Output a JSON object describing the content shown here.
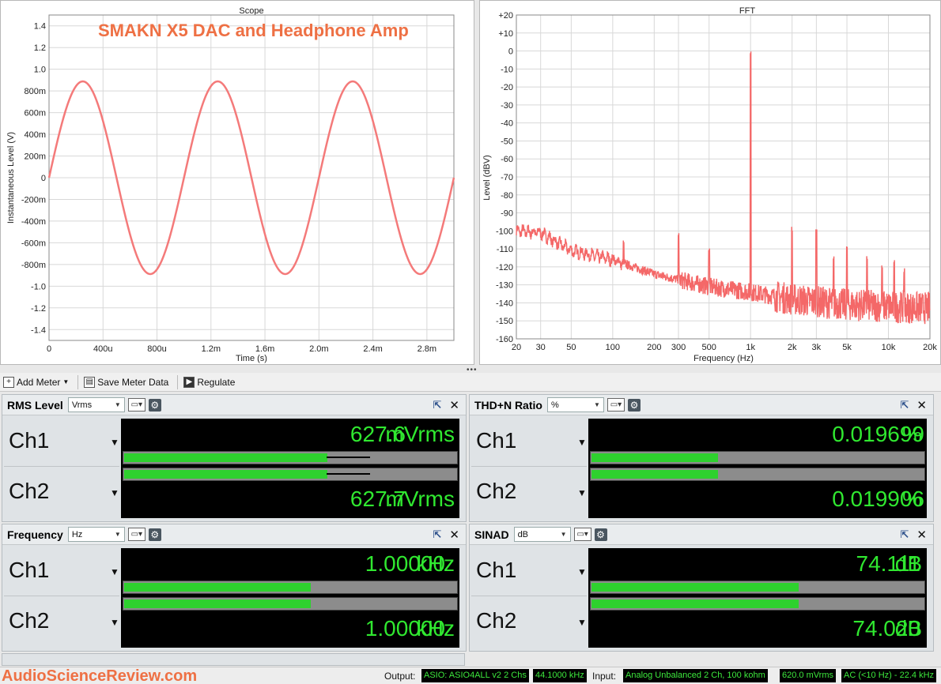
{
  "scope": {
    "title": "Scope",
    "overlay_title": "SMAKN X5 DAC and Headphone Amp",
    "xlabel": "Time (s)",
    "ylabel": "Instantaneous Level (V)",
    "x_ticks": [
      "0",
      "400u",
      "800u",
      "1.2m",
      "1.6m",
      "2.0m",
      "2.4m",
      "2.8m"
    ],
    "y_ticks": [
      "1.4",
      "1.2",
      "1.0",
      "800m",
      "600m",
      "400m",
      "200m",
      "0",
      "-200m",
      "-400m",
      "-600m",
      "-800m",
      "-1.0",
      "-1.2",
      "-1.4"
    ],
    "line_color": "#f47a7a"
  },
  "fft": {
    "title": "FFT",
    "xlabel": "Frequency (Hz)",
    "ylabel": "Level (dBV)",
    "x_ticks": [
      "20",
      "30",
      "50",
      "100",
      "200",
      "300",
      "500",
      "1k",
      "2k",
      "3k",
      "5k",
      "10k",
      "20k"
    ],
    "y_ticks": [
      "+20",
      "+10",
      "0",
      "-10",
      "-20",
      "-30",
      "-40",
      "-50",
      "-60",
      "-70",
      "-80",
      "-90",
      "-100",
      "-110",
      "-120",
      "-130",
      "-140",
      "-150",
      "-160"
    ],
    "line_color": "#f46868"
  },
  "chart_data": [
    {
      "type": "line",
      "title": "Scope",
      "xlabel": "Time (s)",
      "ylabel": "Instantaneous Level (V)",
      "xlim": [
        0,
        0.003
      ],
      "ylim": [
        -1.5,
        1.5
      ],
      "series": [
        {
          "frequency_hz": 1000,
          "amplitude_v": 0.888,
          "start_phase": "rising from 0"
        }
      ]
    },
    {
      "type": "line",
      "title": "FFT",
      "xlabel": "Frequency (Hz)",
      "ylabel": "Level (dBV)",
      "xscale": "log",
      "xlim": [
        20,
        20000
      ],
      "ylim": [
        -160,
        20
      ],
      "series": [
        {
          "fundamental": {
            "x": 1000,
            "y": -4
          },
          "harmonics": [
            {
              "x": 2000,
              "y": -102
            },
            {
              "x": 3000,
              "y": -104
            },
            {
              "x": 4000,
              "y": -118
            },
            {
              "x": 5000,
              "y": -112
            },
            {
              "x": 7000,
              "y": -118
            },
            {
              "x": 9000,
              "y": -123
            },
            {
              "x": 11000,
              "y": -120
            },
            {
              "x": 13000,
              "y": -125
            }
          ],
          "spurs": [
            {
              "x": 120,
              "y": -109
            },
            {
              "x": 300,
              "y": -105
            },
            {
              "x": 500,
              "y": -115
            }
          ],
          "noise_floor": [
            {
              "x": 20,
              "y": -100
            },
            {
              "x": 30,
              "y": -101
            },
            {
              "x": 50,
              "y": -111
            },
            {
              "x": 100,
              "y": -116
            },
            {
              "x": 200,
              "y": -124
            },
            {
              "x": 500,
              "y": -131
            },
            {
              "x": 1000,
              "y": -134
            },
            {
              "x": 2000,
              "y": -138
            },
            {
              "x": 5000,
              "y": -141
            },
            {
              "x": 20000,
              "y": -143
            }
          ]
        }
      ]
    }
  ],
  "toolbar": {
    "add_meter": "Add Meter",
    "save_meter_data": "Save Meter Data",
    "regulate": "Regulate"
  },
  "meters": {
    "rms": {
      "name": "RMS Level",
      "unit": "Vrms",
      "ch1": {
        "label": "Ch1",
        "value": "627.6",
        "unit": "mVrms",
        "bar_fraction": 0.61,
        "peak_fraction": 0.74
      },
      "ch2": {
        "label": "Ch2",
        "value": "627.7",
        "unit": "mVrms",
        "bar_fraction": 0.61,
        "peak_fraction": 0.74
      }
    },
    "thd": {
      "name": "THD+N Ratio",
      "unit": "%",
      "ch1": {
        "label": "Ch1",
        "value": "0.019699",
        "unit": "%",
        "bar_fraction": 0.38
      },
      "ch2": {
        "label": "Ch2",
        "value": "0.019906",
        "unit": "%",
        "bar_fraction": 0.38
      }
    },
    "freq": {
      "name": "Frequency",
      "unit": "Hz",
      "ch1": {
        "label": "Ch1",
        "value": "1.00000",
        "unit": "kHz",
        "bar_fraction": 0.56
      },
      "ch2": {
        "label": "Ch2",
        "value": "1.00000",
        "unit": "kHz",
        "bar_fraction": 0.56
      }
    },
    "sinad": {
      "name": "SINAD",
      "unit": "dB",
      "ch1": {
        "label": "Ch1",
        "value": "74.111",
        "unit": "dB",
        "bar_fraction": 0.62
      },
      "ch2": {
        "label": "Ch2",
        "value": "74.020",
        "unit": "dB",
        "bar_fraction": 0.62
      }
    }
  },
  "status": {
    "brand": "AudioScienceReview.com",
    "output_label": "Output:",
    "output_device": "ASIO: ASIO4ALL v2 2 Chs",
    "output_rate": "44.1000 kHz",
    "input_label": "Input:",
    "input_device": "Analog Unbalanced 2 Ch, 100 kohm",
    "input_range": "620.0 mVrms",
    "input_coupling": "AC (<10 Hz) - 22.4 kHz"
  }
}
